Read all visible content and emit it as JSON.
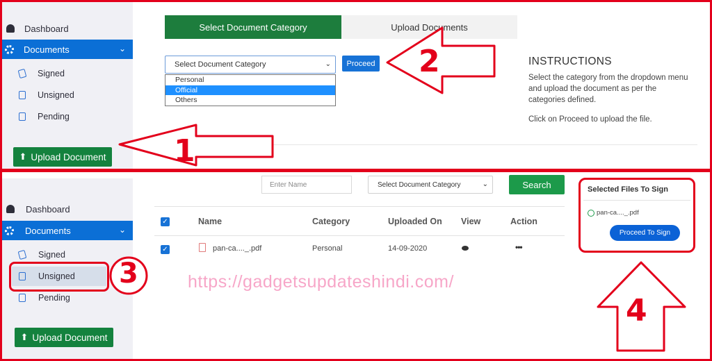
{
  "sidebar": {
    "dashboard": "Dashboard",
    "documents": "Documents",
    "signed": "Signed",
    "unsigned": "Unsigned",
    "pending": "Pending",
    "upload_button": "Upload Document"
  },
  "top": {
    "tab_active": "Select Document Category",
    "tab_inactive": "Upload Documents",
    "select_value": "Select Document Category",
    "options": [
      "Personal",
      "Official",
      "Others"
    ],
    "selected_option": "Official",
    "proceed": "Proceed",
    "instructions_title": "INSTRUCTIONS",
    "instructions_text": "Select the category from the dropdown menu and upload the document as per the categories defined.",
    "instructions_text2": "Click on Proceed to upload the file."
  },
  "bottom": {
    "name_placeholder": "Enter Name",
    "category_select": "Select Document Category",
    "search": "Search",
    "columns": [
      "Name",
      "Category",
      "Uploaded On",
      "View",
      "Action"
    ],
    "rows": [
      {
        "name": "pan-ca...._.pdf",
        "category": "Personal",
        "uploaded_on": "14-09-2020",
        "action": "•••"
      }
    ],
    "selected_files_title": "Selected Files To Sign",
    "selected_file": "pan-ca...._.pdf",
    "proceed_to_sign": "Proceed To Sign"
  },
  "watermark": "https://gadgetsupdateshindi.com/",
  "annotation_numbers": [
    "1",
    "2",
    "3",
    "4"
  ],
  "colors": {
    "annotation_red": "#e3001b",
    "primary_blue": "#0b6fd6",
    "green": "#14823e",
    "watermark_pink": "#f7a6c8"
  }
}
